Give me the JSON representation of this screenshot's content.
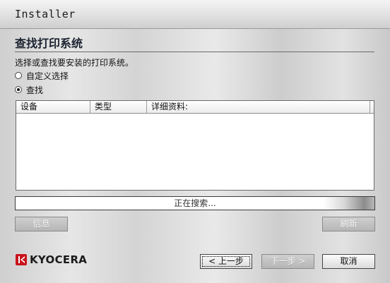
{
  "window": {
    "title": "Installer"
  },
  "page": {
    "heading": "查找打印系统",
    "instruction": "选择或查找要安装的打印系统。"
  },
  "options": [
    {
      "label": "自定义选择",
      "selected": false
    },
    {
      "label": "查找",
      "selected": true
    }
  ],
  "device_list": {
    "columns": [
      "设备",
      "类型",
      "详细资料:"
    ],
    "rows": []
  },
  "progress": {
    "status_text": "正在搜索..."
  },
  "buttons": {
    "info": "信息",
    "refresh": "刷新",
    "back": "< 上一步",
    "next": "下一步 >",
    "cancel": "取消"
  },
  "brand": {
    "logo_text": "KYOCERA",
    "logo_color": "#c9141c"
  }
}
